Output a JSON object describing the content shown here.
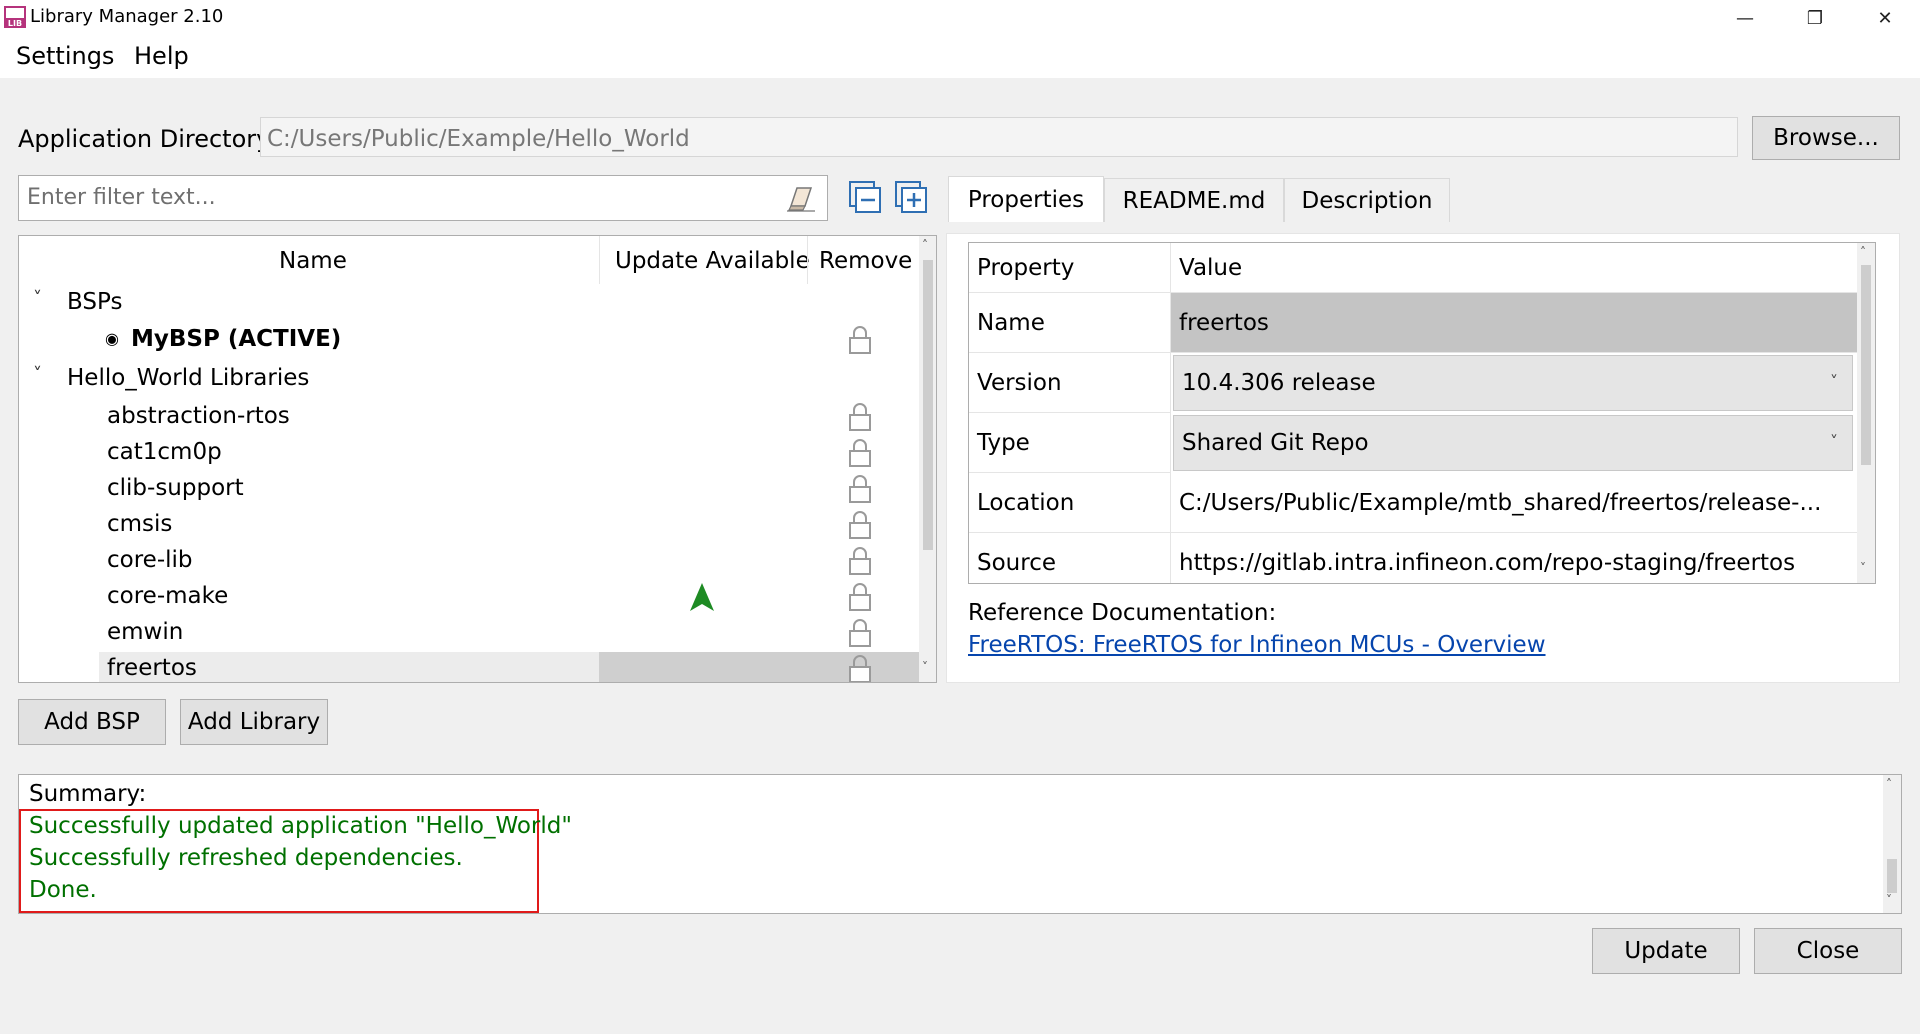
{
  "window": {
    "title": "Library Manager 2.10",
    "icon_text": "LIB",
    "minimize_glyph": "—",
    "restore_glyph": "❐",
    "close_glyph": "✕"
  },
  "menu": [
    "Settings",
    "Help"
  ],
  "app_directory": {
    "label": "Application Directory:",
    "value": "C:/Users/Public/Example/Hello_World",
    "browse_label": "Browse..."
  },
  "filter": {
    "placeholder": "Enter filter text..."
  },
  "tree": {
    "columns": [
      "Name",
      "Update Available",
      "Remove"
    ],
    "groups": [
      {
        "label": "BSPs",
        "items": [
          "MyBSP (ACTIVE)"
        ]
      },
      {
        "label": "Hello_World Libraries",
        "items": [
          "abstraction-rtos",
          "cat1cm0p",
          "clib-support",
          "cmsis",
          "core-lib",
          "core-make",
          "emwin",
          "freertos"
        ]
      }
    ],
    "selected_item": "freertos"
  },
  "buttons": {
    "add_bsp": "Add BSP",
    "add_library": "Add Library",
    "update": "Update",
    "close": "Close"
  },
  "tabs": [
    "Properties",
    "README.md",
    "Description"
  ],
  "properties": {
    "headers": [
      "Property",
      "Value"
    ],
    "rows": [
      {
        "key": "Name",
        "value": "freertos"
      },
      {
        "key": "Version",
        "value": "10.4.306 release"
      },
      {
        "key": "Type",
        "value": "Shared Git Repo"
      },
      {
        "key": "Location",
        "value": "C:/Users/Public/Example/mtb_shared/freertos/release-..."
      },
      {
        "key": "Source",
        "value": "https://gitlab.intra.infineon.com/repo-staging/freertos"
      }
    ]
  },
  "reference": {
    "label": "Reference Documentation:",
    "link": "FreeRTOS: FreeRTOS for Infineon MCUs - Overview"
  },
  "summary": {
    "label": "Summary:",
    "lines": [
      "Successfully updated application \"Hello_World\"",
      "Successfully refreshed dependencies.",
      "Done."
    ]
  },
  "colors": {
    "success": "#007000",
    "highlight": "#e01a1a",
    "link": "#0645ad",
    "update_arrow": "#1e8b24"
  }
}
